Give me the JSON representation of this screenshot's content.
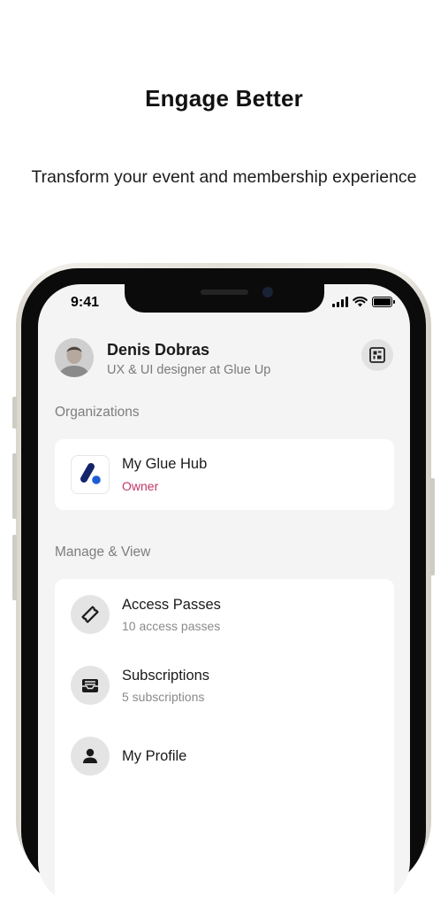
{
  "headline": "Engage Better",
  "subline": "Transform your event and membership experience",
  "status_bar": {
    "time": "9:41"
  },
  "profile": {
    "name": "Denis Dobras",
    "role": "UX & UI designer at Glue Up"
  },
  "organizations": {
    "section_title": "Organizations",
    "items": [
      {
        "name": "My Glue Hub",
        "role": "Owner",
        "icon": "glue-up-logo"
      }
    ]
  },
  "manage": {
    "section_title": "Manage & View",
    "items": [
      {
        "title": "Access Passes",
        "subtitle": "10 access passes",
        "icon": "ticket-icon"
      },
      {
        "title": "Subscriptions",
        "subtitle": "5 subscriptions",
        "icon": "inbox-icon"
      },
      {
        "title": "My Profile",
        "icon": "person-icon"
      }
    ]
  },
  "colors": {
    "owner_accent": "#c2366a",
    "logo_blue": "#13246b",
    "logo_dot_blue": "#1d5cd6",
    "screen_bg": "#f4f4f4"
  }
}
